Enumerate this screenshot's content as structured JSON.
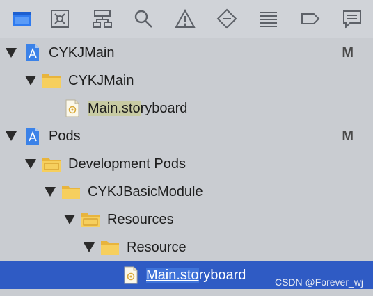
{
  "toolbar": {
    "icons": [
      {
        "name": "project-navigator-icon",
        "active": true
      },
      {
        "name": "source-control-icon",
        "active": false
      },
      {
        "name": "symbol-navigator-icon",
        "active": false
      },
      {
        "name": "find-navigator-icon",
        "active": false
      },
      {
        "name": "issue-navigator-icon",
        "active": false
      },
      {
        "name": "test-navigator-icon",
        "active": false
      },
      {
        "name": "debug-navigator-icon",
        "active": false
      },
      {
        "name": "breakpoint-navigator-icon",
        "active": false
      },
      {
        "name": "report-navigator-icon",
        "active": false
      }
    ]
  },
  "tree": {
    "items": [
      {
        "label": "CYKJMain",
        "icon": "xcode-project-icon",
        "status": "M"
      },
      {
        "label": "CYKJMain",
        "icon": "folder-icon"
      },
      {
        "label_main": "Main.storyboard",
        "highlight": "Main.sto",
        "rest": "ryboard",
        "icon": "storyboard-file-icon"
      },
      {
        "label": "Pods",
        "icon": "xcode-project-icon",
        "status": "M"
      },
      {
        "label": "Development Pods",
        "icon": "group-folder-icon"
      },
      {
        "label": "CYKJBasicModule",
        "icon": "folder-icon"
      },
      {
        "label": "Resources",
        "icon": "group-folder-icon"
      },
      {
        "label": "Resource",
        "icon": "folder-icon"
      },
      {
        "label_main": "Main.storyboard",
        "highlight": "Main.sto",
        "rest": "ryboard",
        "icon": "storyboard-file-icon",
        "selected": true
      }
    ]
  },
  "watermark": "CSDN @Forever_wj",
  "colors": {
    "background": "#c9ccd1",
    "selection": "#2f5bc4",
    "folder": "#f3c34d",
    "accent": "#2f7bf0"
  }
}
